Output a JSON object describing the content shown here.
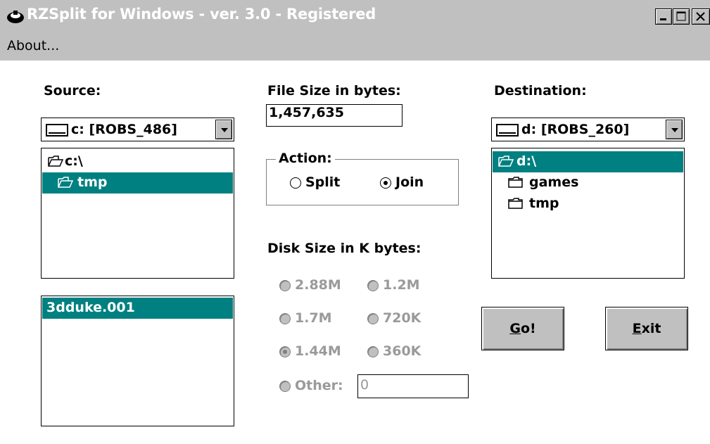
{
  "window": {
    "title": "RZSplit for Windows - ver. 3.0 - Registered",
    "controls": [
      "minimize-icon",
      "maximize-icon",
      "close-icon"
    ]
  },
  "menu": {
    "about": "About..."
  },
  "source": {
    "label": "Source:",
    "drive": "c: [ROBS_486]",
    "dirs": [
      {
        "name": "c:\\",
        "icon": "open-folder-icon",
        "selected": false
      },
      {
        "name": "tmp",
        "icon": "open-folder-icon",
        "selected": true
      }
    ],
    "files": [
      {
        "name": "3dduke.001",
        "selected": true
      }
    ]
  },
  "file_size": {
    "label": "File Size in bytes:",
    "value": "1,457,635"
  },
  "action": {
    "label": "Action:",
    "options": [
      {
        "label": "Split",
        "checked": false
      },
      {
        "label": "Join",
        "checked": true
      }
    ]
  },
  "disk_size": {
    "label": "Disk Size in K bytes:",
    "options": [
      {
        "label": "2.88M",
        "checked": false
      },
      {
        "label": "1.2M",
        "checked": false
      },
      {
        "label": "1.7M",
        "checked": false
      },
      {
        "label": "720K",
        "checked": false
      },
      {
        "label": "1.44M",
        "checked": true
      },
      {
        "label": "360K",
        "checked": false
      },
      {
        "label": "Other:",
        "checked": false
      }
    ],
    "other_value": "0",
    "enabled": false
  },
  "destination": {
    "label": "Destination:",
    "drive": "d: [ROBS_260]",
    "dirs": [
      {
        "name": "d:\\",
        "icon": "open-folder-icon",
        "selected": true
      },
      {
        "name": "games",
        "icon": "folder-icon",
        "selected": false
      },
      {
        "name": "tmp",
        "icon": "folder-icon",
        "selected": false
      }
    ]
  },
  "buttons": {
    "go_mnemonic": "G",
    "go_rest": "o!",
    "exit_mnemonic": "E",
    "exit_rest": "xit"
  },
  "colors": {
    "selection": "#008080",
    "face": "#c0c0c0",
    "disabled_text": "#9a9a9a"
  }
}
